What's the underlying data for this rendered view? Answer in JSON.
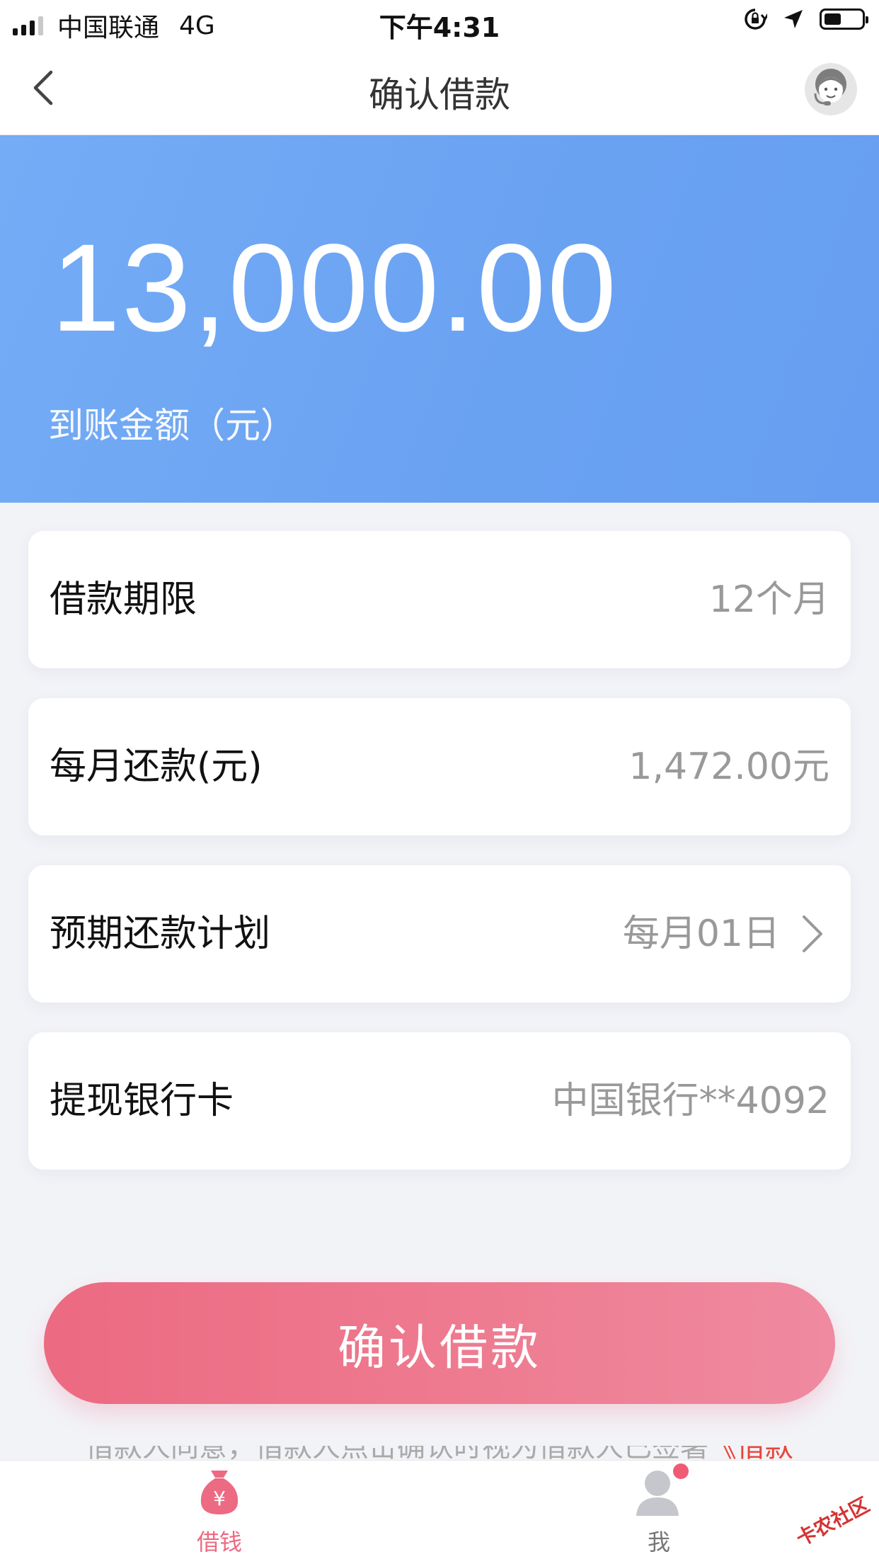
{
  "status_bar": {
    "carrier": "中国联通",
    "network": "4G",
    "time": "下午4:31",
    "battery_level": 0.45
  },
  "nav": {
    "title": "确认借款",
    "back_icon": "chevron-left-icon",
    "service_icon": "customer-service-avatar-icon"
  },
  "hero": {
    "amount": "13,000.00",
    "label": "到账金额（元）",
    "color": "#6ea6f4"
  },
  "rows": [
    {
      "label": "借款期限",
      "value": "12个月"
    },
    {
      "label": "每月还款(元)",
      "value": "1,472.00元"
    },
    {
      "label": "预期还款计划",
      "value": "每月01日"
    },
    {
      "label": "提现银行卡",
      "value": "中国银行**4092"
    }
  ],
  "confirm_button": {
    "label": "确认借款",
    "color": "#ec6a82"
  },
  "agreement": {
    "text": "借款人同意，借款人点击确认时视为借款人已签署",
    "link": "《借款"
  },
  "tabbar": {
    "items": [
      {
        "label": "借钱",
        "icon": "money-bag-icon",
        "active": true
      },
      {
        "label": "我",
        "icon": "user-profile-icon",
        "active": false,
        "badge": true
      }
    ]
  },
  "watermark": "卡农社区"
}
